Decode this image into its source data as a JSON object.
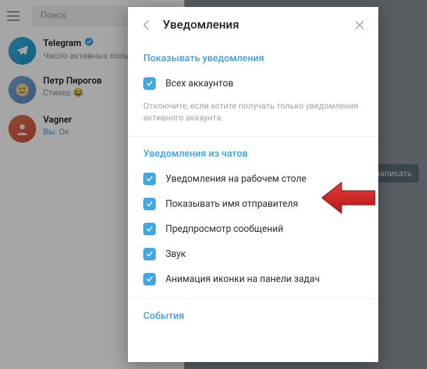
{
  "search": {
    "placeholder": "Поиск"
  },
  "chats": [
    {
      "title": "Telegram",
      "subtitle": "Число активных поль",
      "you": ""
    },
    {
      "title": "Петр Пирогов",
      "subtitle": "Стикер 😂",
      "you": ""
    },
    {
      "title": "Vagner",
      "subtitle": "Ок",
      "you": "Вы: "
    }
  ],
  "writeLabel": "написать",
  "modal": {
    "title": "Уведомления",
    "section1": "Показывать уведомления",
    "opt_all_accounts": "Всех аккаунтов",
    "hint": "Отключите, если хотите получать только уведомления активного аккаунта.",
    "section2": "Уведомления из чатов",
    "opt_desktop": "Уведомления на рабочем столе",
    "opt_sender": "Показывать имя отправителя",
    "opt_preview": "Предпросмотр сообщений",
    "opt_sound": "Звук",
    "opt_anim": "Анимация иконки на панели задач",
    "section3": "События"
  }
}
